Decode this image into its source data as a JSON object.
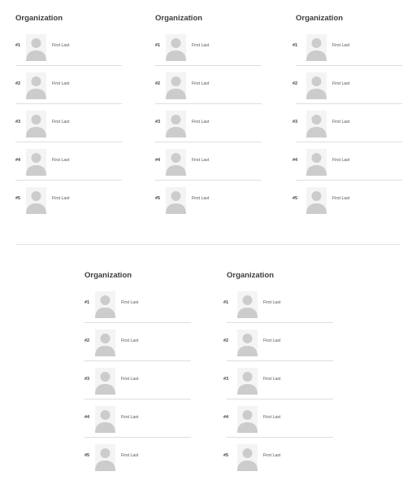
{
  "cards": [
    {
      "title": "Organization",
      "entries": [
        {
          "rank": "#1",
          "name": "First Last"
        },
        {
          "rank": "#2",
          "name": "First Last"
        },
        {
          "rank": "#3",
          "name": "First Last"
        },
        {
          "rank": "#4",
          "name": "First Last"
        },
        {
          "rank": "#5",
          "name": "First Last"
        }
      ]
    },
    {
      "title": "Organization",
      "entries": [
        {
          "rank": "#1",
          "name": "First Last"
        },
        {
          "rank": "#2",
          "name": "First Last"
        },
        {
          "rank": "#3",
          "name": "First Last"
        },
        {
          "rank": "#4",
          "name": "First Last"
        },
        {
          "rank": "#5",
          "name": "First Last"
        }
      ]
    },
    {
      "title": "Organization",
      "entries": [
        {
          "rank": "#1",
          "name": "First Last"
        },
        {
          "rank": "#2",
          "name": "First Last"
        },
        {
          "rank": "#3",
          "name": "First Last"
        },
        {
          "rank": "#4",
          "name": "First Last"
        },
        {
          "rank": "#5",
          "name": "First Last"
        }
      ]
    },
    {
      "title": "Organization",
      "entries": [
        {
          "rank": "#1",
          "name": "First Last"
        },
        {
          "rank": "#2",
          "name": "First Last"
        },
        {
          "rank": "#3",
          "name": "First Last"
        },
        {
          "rank": "#4",
          "name": "First Last"
        },
        {
          "rank": "#5",
          "name": "First Last"
        }
      ]
    },
    {
      "title": "Organization",
      "entries": [
        {
          "rank": "#1",
          "name": "First Last"
        },
        {
          "rank": "#2",
          "name": "First Last"
        },
        {
          "rank": "#3",
          "name": "First Last"
        },
        {
          "rank": "#4",
          "name": "First Last"
        },
        {
          "rank": "#5",
          "name": "First Last"
        }
      ]
    }
  ],
  "icons": {
    "avatar": "user-placeholder-icon"
  },
  "colors": {
    "avatar_bg": "#f4f4f4",
    "avatar_fg": "#cccccc",
    "divider": "#dedede"
  }
}
